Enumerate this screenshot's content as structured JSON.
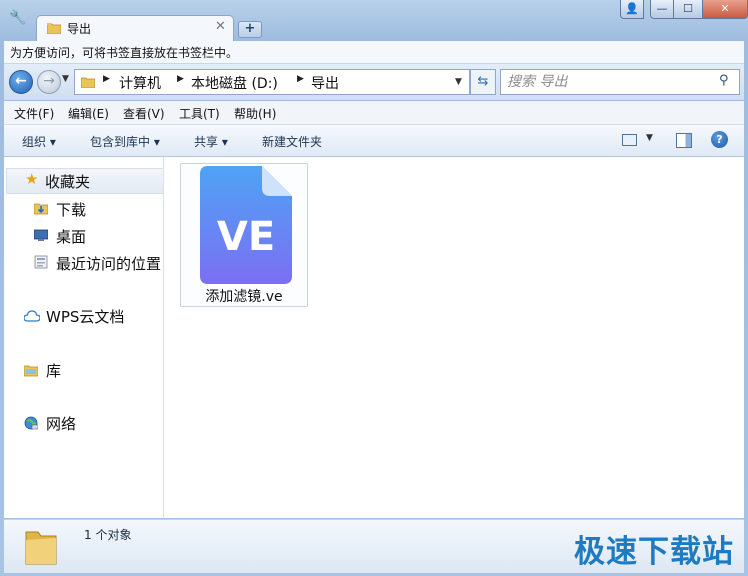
{
  "tab": {
    "title": "导出"
  },
  "bookmark_bar": {
    "hint": "为方便访问，可将书签直接放在书签栏中。"
  },
  "address": {
    "crumbs": [
      "计算机",
      "本地磁盘 (D:)",
      "导出"
    ]
  },
  "search": {
    "placeholder": "搜索 导出"
  },
  "menu": {
    "items": [
      "文件(F)",
      "编辑(E)",
      "查看(V)",
      "工具(T)",
      "帮助(H)"
    ]
  },
  "toolbar": {
    "organize": "组织 ▾",
    "include": "包含到库中 ▾",
    "share": "共享 ▾",
    "new_folder": "新建文件夹"
  },
  "nav": {
    "favorites": "收藏夹",
    "download": "下载",
    "desktop": "桌面",
    "recent": "最近访问的位置",
    "wps": "WPS云文档",
    "library": "库",
    "network": "网络"
  },
  "files": [
    {
      "name": "添加滤镜.ve",
      "icon_text": "VE"
    }
  ],
  "status": {
    "count": "1 个对象"
  },
  "watermark": "极速下载站",
  "colors": {
    "accent": "#1e7bc2",
    "ve_icon_top": "#4ea3f5",
    "ve_icon_bottom": "#7b6ff2"
  }
}
